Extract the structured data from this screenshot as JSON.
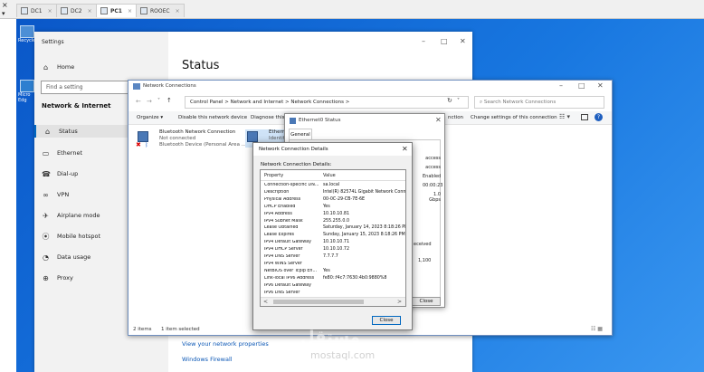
{
  "vm_tabs": {
    "close_glyph": "×",
    "drop_glyph": "▾",
    "tab_close_glyph": "×",
    "items": [
      {
        "label": "DC1"
      },
      {
        "label": "DC2"
      },
      {
        "label": "PC1"
      },
      {
        "label": "ROOEC"
      }
    ]
  },
  "desktop": {
    "icons": [
      {
        "label": "Recycle"
      },
      {
        "label": "Micro Edg"
      }
    ]
  },
  "settings": {
    "window_title": "Settings",
    "controls": {
      "min": "–",
      "max": "□",
      "close": "✕"
    },
    "home_label": "Home",
    "find_placeholder": "Find a setting",
    "category": "Network & Internet",
    "nav": [
      {
        "label": "Status",
        "icon": "home-icon"
      },
      {
        "label": "Ethernet",
        "icon": "ethernet-icon"
      },
      {
        "label": "Dial-up",
        "icon": "phone-icon"
      },
      {
        "label": "VPN",
        "icon": "vpn-icon"
      },
      {
        "label": "Airplane mode",
        "icon": "airplane-icon"
      },
      {
        "label": "Mobile hotspot",
        "icon": "hotspot-icon"
      },
      {
        "label": "Data usage",
        "icon": "data-usage-icon"
      },
      {
        "label": "Proxy",
        "icon": "globe-icon"
      }
    ],
    "page_title": "Status",
    "link_properties": "View your network properties",
    "link_firewall": "Windows Firewall"
  },
  "explorer": {
    "window_title": "Network Connections",
    "controls": {
      "min": "–",
      "max": "□",
      "close": "✕"
    },
    "address": "Control Panel  >  Network and Internet  >  Network Connections  >",
    "search_placeholder": "Search Network Connections",
    "commands": {
      "organize": "Organize ▾",
      "disable": "Disable this network device",
      "diagnose": "Diagnose this co",
      "connection": "nction",
      "change_settings": "Change settings of this connection"
    },
    "connections": [
      {
        "name": "Bluetooth Network Connection",
        "status": "Not connected",
        "device": "Bluetooth Device (Personal Area ..."
      },
      {
        "name": "Etherne",
        "status": "Identify"
      }
    ],
    "statusbar": {
      "items": "2 items",
      "selected": "1 item selected"
    }
  },
  "ethernet_status": {
    "title": "Ethernet0 Status",
    "tab": "General",
    "values": [
      "access",
      "access",
      "Enabled",
      "00:00:23",
      "1.0 Gbps"
    ],
    "received_label": "eceived",
    "received_value": "1,100",
    "close_label": "Close"
  },
  "details": {
    "title": "Network Connection Details",
    "close_glyph": "✕",
    "heading": "Network Connection Details:",
    "col_property": "Property",
    "col_value": "Value",
    "rows": [
      {
        "p": "Connection-specific DN...",
        "v": "sa.local"
      },
      {
        "p": "Description",
        "v": "Intel(R) 82574L Gigabit Network Connect"
      },
      {
        "p": "Physical Address",
        "v": "00-0C-29-CB-7E-6E"
      },
      {
        "p": "DHCP Enabled",
        "v": "Yes"
      },
      {
        "p": "IPv4 Address",
        "v": "10.10.10.81"
      },
      {
        "p": "IPv4 Subnet Mask",
        "v": "255.255.0.0"
      },
      {
        "p": "Lease Obtained",
        "v": "Saturday, January 14, 2023 8:18:26 PM"
      },
      {
        "p": "Lease Expires",
        "v": "Sunday, January 15, 2023 8:18:26 PM"
      },
      {
        "p": "IPv4 Default Gateway",
        "v": "10.10.10.71"
      },
      {
        "p": "IPv4 DHCP Server",
        "v": "10.10.10.72"
      },
      {
        "p": "IPv4 DNS Server",
        "v": "7.7.7.7"
      },
      {
        "p": "IPv4 WINS Server",
        "v": ""
      },
      {
        "p": "NetBIOS over Tcpip En...",
        "v": "Yes"
      },
      {
        "p": "Link-local IPv6 Address",
        "v": "fe80::f4c7:7630:4b0:9880%8"
      },
      {
        "p": "IPv6 Default Gateway",
        "v": ""
      },
      {
        "p": "IPv6 DNS Server",
        "v": ""
      }
    ],
    "scroll_left": "<",
    "scroll_right": ">",
    "close_label": "Close"
  },
  "watermark": {
    "arabic": "مستقل",
    "latin": "mostaql.com"
  }
}
